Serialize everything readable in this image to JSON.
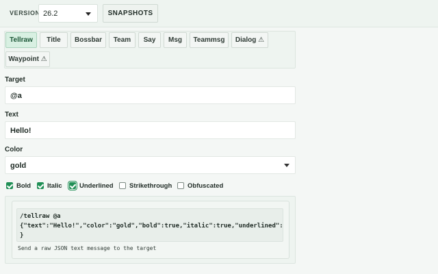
{
  "toolbar": {
    "version_label": "VERSION",
    "version_value": "26.2",
    "snapshots_label": "SNAPSHOTS"
  },
  "tabs": [
    {
      "label": "Tellraw",
      "active": true
    },
    {
      "label": "Title"
    },
    {
      "label": "Bossbar"
    },
    {
      "label": "Team"
    },
    {
      "label": "Say"
    },
    {
      "label": "Msg"
    },
    {
      "label": "Teammsg"
    },
    {
      "label": "Dialog ⚠"
    },
    {
      "label": "Waypoint ⚠"
    }
  ],
  "form": {
    "target": {
      "label": "Target",
      "value": "@a"
    },
    "text": {
      "label": "Text",
      "value": "Hello!"
    },
    "color": {
      "label": "Color",
      "value": "gold"
    }
  },
  "checkboxes": [
    {
      "label": "Bold",
      "checked": true
    },
    {
      "label": "Italic",
      "checked": true
    },
    {
      "label": "Underlined",
      "checked": true
    },
    {
      "label": "Strikethrough",
      "checked": false
    },
    {
      "label": "Obfuscated",
      "checked": false
    }
  ],
  "output": {
    "command_line1": "/tellraw @a",
    "command_line2": "{\"text\":\"Hello!\",\"color\":\"gold\",\"bold\":true,\"italic\":true,\"underlined\":true",
    "command_line3": "}",
    "description": "Send a raw JSON text message to the target"
  },
  "colors": {
    "accent": "#1f8f55",
    "active_tab_bg": "#d8f0e2"
  }
}
